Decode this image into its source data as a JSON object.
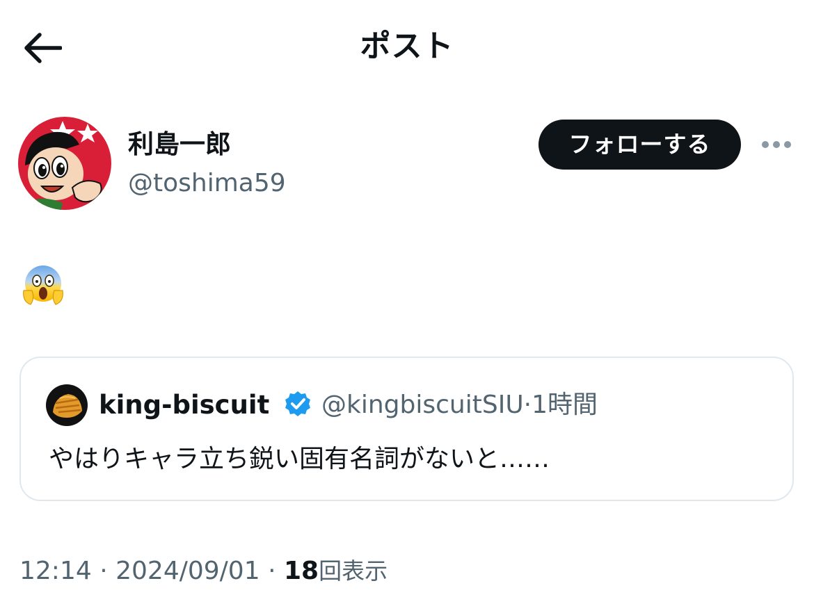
{
  "header": {
    "title": "ポスト",
    "back_icon": "arrow-left-icon"
  },
  "author": {
    "display_name": "利島一郎",
    "handle": "@toshima59",
    "follow_label": "フォローする",
    "more_icon": "ellipsis-icon"
  },
  "post": {
    "text_emoji": "face-screaming-in-fear-emoji"
  },
  "quote": {
    "display_name": "king-biscuit",
    "verified_icon": "verified-badge-icon",
    "handle": "@kingbiscuitSIU",
    "separator": "·",
    "time": "1時間",
    "text": "やはりキャラ立ち鋭い固有名詞がないと……"
  },
  "meta": {
    "time": "12:14",
    "date": "2024/09/01",
    "separator": "·",
    "views_count": "18",
    "views_label": "回表示"
  },
  "colors": {
    "text_primary": "#0f1419",
    "text_secondary": "#536471",
    "border": "#e1e8ed",
    "follow_bg": "#0f1419",
    "verified": "#1d9bf0"
  }
}
